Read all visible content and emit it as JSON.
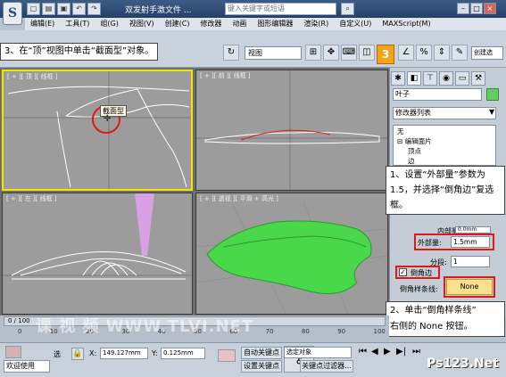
{
  "titlebar": {
    "title": "双发射手激文件 ...",
    "search_placeholder": "键入关键字或短语",
    "logo_glyph": "S"
  },
  "menu": [
    "编辑(E)",
    "工具(T)",
    "组(G)",
    "视图(V)",
    "创建(C)",
    "修改器",
    "动画",
    "图形编辑器",
    "渲染(R)",
    "自定义(U)",
    "MAXScript(M)"
  ],
  "toolbar": {
    "view_select": "视图",
    "snap_label": "3",
    "create_label": "创建选"
  },
  "steps": {
    "step3": "3、在“顶”视图中单击“截面型”对象。",
    "step1": "1、设置“外部量”参数为 1.5，并选择“倒角边”复选框。",
    "step1_lines": [
      "1、设置“外部量”参",
      "数为 1.5，并选择“倒",
      "角边”复选框。"
    ],
    "step2_lines": [
      "2、单击“倒角样条线”",
      "右侧的 None 按钮。"
    ]
  },
  "viewports": {
    "top": "[ + ][ 顶 ][ 线框 ]",
    "front": "[ + ][ 前 ][ 线框 ]",
    "left": "[ + ][ 左 ][ 线框 ]",
    "persp": "[ + ][ 透视 ][ 平滑 + 高光 ]",
    "tooltip": "截面型"
  },
  "cmdpanel": {
    "object_name": "叶子",
    "modifier_list": "修改器列表",
    "stack": [
      "无",
      "⊟ 编辑面片",
      "顶点",
      "边",
      "面片"
    ],
    "inner_label": "内部量",
    "inner_value": "0.0mm",
    "outer_label": "外部量:",
    "outer_value": "1.5mm",
    "segments_label": "分段:",
    "segments_value": "1",
    "bevel_edge": "倒角边",
    "bevel_spline_label": "倒角样条线:",
    "bevel_spline_button": "None"
  },
  "trackbar": {
    "frame": "0 / 100",
    "ticks": [
      "0",
      "10",
      "20",
      "30",
      "40",
      "50",
      "60",
      "70",
      "80",
      "90",
      "100"
    ]
  },
  "statusbar": {
    "welcome": "欢迎使用",
    "sel_label": "选",
    "x_label": "X:",
    "x_value": "149.127mm",
    "y_label": "Y:",
    "y_value": "0.125mm",
    "autokey": "自动关键点",
    "setkey": "设置关键点",
    "select_obj": "选定对象",
    "key_filter": "关键点过滤器..."
  },
  "watermark": {
    "text": "课 视 频 WWW.TLVI.NET",
    "logo": "Ps123.Net"
  },
  "colors": {
    "accent": "#f4a21c",
    "highlight": "#e01818",
    "active_viewport": "#f2e600",
    "leaf_green": "#49d84a",
    "pink": "#d9a0e6"
  }
}
